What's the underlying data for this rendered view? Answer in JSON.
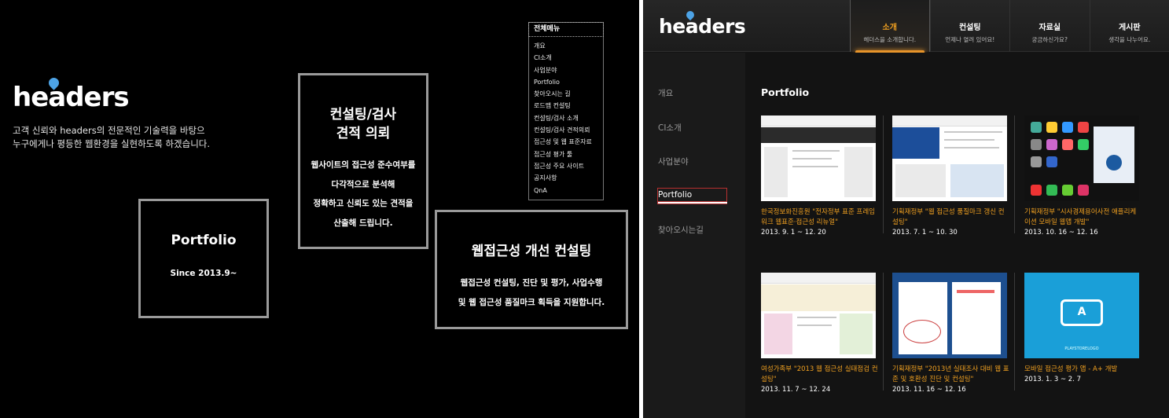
{
  "logo": {
    "pre": "he",
    "a": "a",
    "post": "ders"
  },
  "left": {
    "description": [
      "고객 신뢰와 headers의 전문적인 기술력을 바탕으",
      "누구에게나 평등한 웹환경을 실현하도록 하겠습니다."
    ],
    "portfolio_box": {
      "title": "Portfolio",
      "body": "Since 2013.9~"
    },
    "estimate_box": {
      "title_1": "컨설팅/검사",
      "title_2": "견적 의뢰",
      "body": [
        "웹사이트의 접근성 준수여부를",
        "다각적으로 분석해",
        "정확하고 신뢰도 있는 견적을",
        "산출해 드립니다."
      ]
    },
    "consult_box": {
      "title": "웹접근성 개선 컨설팅",
      "body": [
        "웹접근성 컨설팅, 진단 및 평가, 사업수행",
        "및 웹 접근성 품질마크 획득을 지원합니다."
      ]
    },
    "all_menu": {
      "title": "전체메뉴",
      "items": [
        "개요",
        "CI소개",
        "사업분야",
        "Portfolio",
        "찾아오시는 길",
        "로드맵 컨설팅",
        "컨설팅/검사 소개",
        "컨설팅/검사 견적의뢰",
        "접근성 및 웹 표준자료",
        "접근성 평가 툴",
        "접근성 주요 사이트",
        "공지사항",
        "QnA"
      ]
    }
  },
  "right": {
    "nav": [
      {
        "label": "소개",
        "sub": "헤더스을 소개합니다.",
        "active": true
      },
      {
        "label": "컨설팅",
        "sub": "언제나 열려 있어요!",
        "active": false
      },
      {
        "label": "자료실",
        "sub": "궁금하신가요?",
        "active": false
      },
      {
        "label": "게시판",
        "sub": "생각을 나누어요.",
        "active": false
      }
    ],
    "side": [
      "개요",
      "CI소개",
      "사업분야",
      "Portfolio",
      "찾아오시는길"
    ],
    "main_title": "Portfolio",
    "portfolio": [
      {
        "caption": "한국정보화진흥원 \"전자정부 표준 프레임워크 웹표준·접근성 리뉴얼\"",
        "date": "2013. 9. 1 ~ 12. 20"
      },
      {
        "caption": "기획재정부 \"웹 접근성 품질마크 갱신 컨설팅\"",
        "date": "2013. 7. 1 ~ 10. 30"
      },
      {
        "caption": "기획재정부 \"시사경제용어사전 애플리케이션 모바일 웹앱 개발\"",
        "date": "2013. 10. 16 ~ 12. 16"
      },
      {
        "caption": "여성가족부 \"2013 웹 접근성 실태점검 컨설팅\"",
        "date": "2013. 11. 7 ~ 12. 24"
      },
      {
        "caption": "기획재정부 \"2013년 실태조사 대비 웹 표준 및 호환성 진단 및 컨설팅\"",
        "date": "2013. 11. 16 ~ 12. 16"
      },
      {
        "caption": "모바일 접근성 평가 앱 - A+ 개발",
        "date": "2013. 1. 3 ~ 2. 7"
      }
    ],
    "thumb_badge": {
      "letter": "A",
      "text": "PLAYSTORELOGO"
    }
  },
  "colors": {
    "accent_orange": "#f0a020",
    "logo_drop_blue": "#4da3e6",
    "active_side_border": "#b83030",
    "teal_thumb": "#1a9fd8"
  }
}
